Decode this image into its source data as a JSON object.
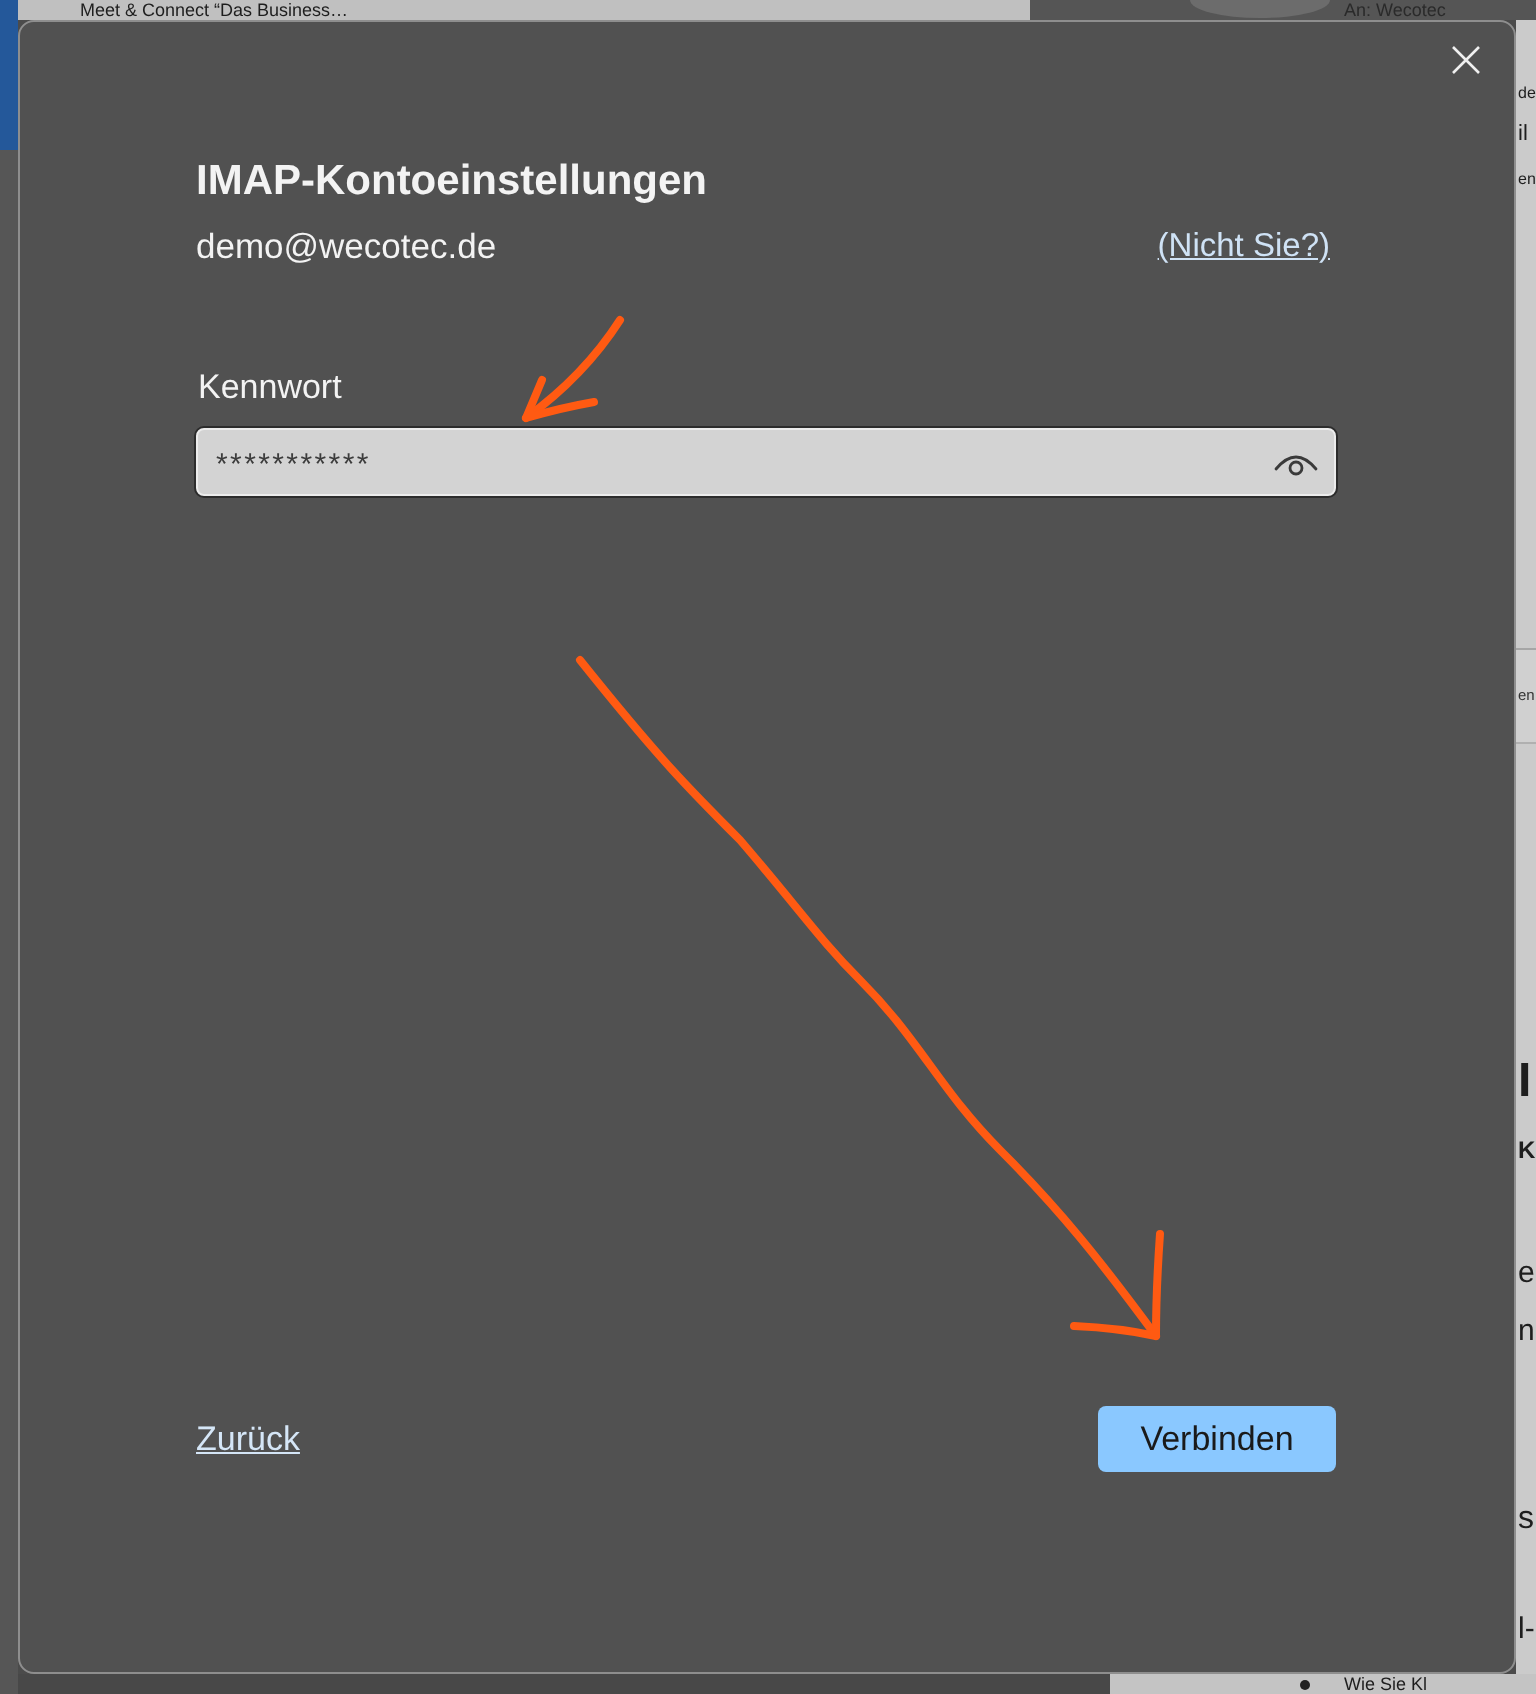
{
  "background_app": {
    "header_title": "Meet & Connect “Das Business…",
    "recipient": "An: Wecotec",
    "side_fragments_top": [
      "de",
      "il",
      "en"
    ],
    "side_tab": "en",
    "side_fragments_lower": [
      "I",
      "K",
      "e",
      "n",
      "s",
      "l-"
    ],
    "list_item": "Wie Sie Kl"
  },
  "dialog": {
    "title": "IMAP-Kontoeinstellungen",
    "account_email": "demo@wecotec.de",
    "not_you_link": "(Nicht Sie?)",
    "password_label": "Kennwort",
    "password_value": "***********",
    "back_link": "Zurück",
    "connect_button": "Verbinden"
  }
}
